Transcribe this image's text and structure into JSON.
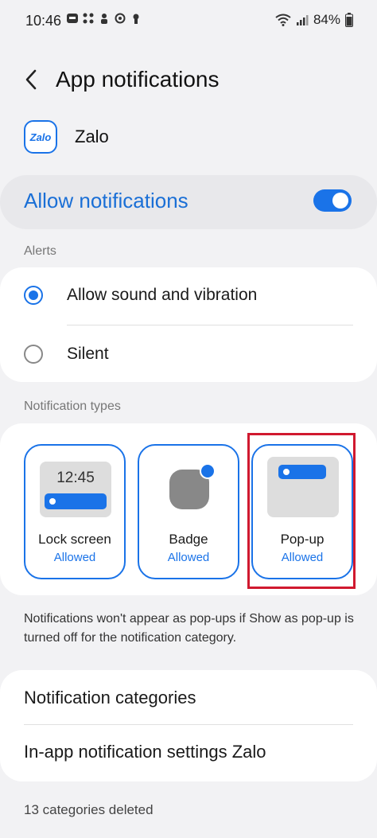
{
  "status_bar": {
    "time": "10:46",
    "battery": "84%",
    "icons": [
      "zalo-notification-icon",
      "cluster-icon",
      "person-icon",
      "circle-icon",
      "keyhole-icon",
      "wifi-icon",
      "signal-icon",
      "battery-icon"
    ]
  },
  "header": {
    "title": "App notifications"
  },
  "app": {
    "logo_text": "Zalo",
    "name": "Zalo"
  },
  "allow": {
    "label": "Allow notifications",
    "enabled": true
  },
  "alerts": {
    "section_label": "Alerts",
    "options": [
      {
        "label": "Allow sound and vibration",
        "selected": true
      },
      {
        "label": "Silent",
        "selected": false
      }
    ]
  },
  "notification_types": {
    "section_label": "Notification types",
    "lock_screen_time": "12:45",
    "tiles": [
      {
        "label": "Lock screen",
        "status": "Allowed"
      },
      {
        "label": "Badge",
        "status": "Allowed"
      },
      {
        "label": "Pop-up",
        "status": "Allowed"
      }
    ]
  },
  "note": "Notifications won't appear as pop-ups if Show as pop-up is turned off for the notification category.",
  "menu": {
    "items": [
      {
        "label": "Notification categories"
      },
      {
        "label": "In-app notification settings Zalo"
      }
    ]
  },
  "footer": "13 categories deleted",
  "colors": {
    "accent": "#1a73e8",
    "highlight": "#d0192f",
    "background": "#f2f2f4"
  }
}
